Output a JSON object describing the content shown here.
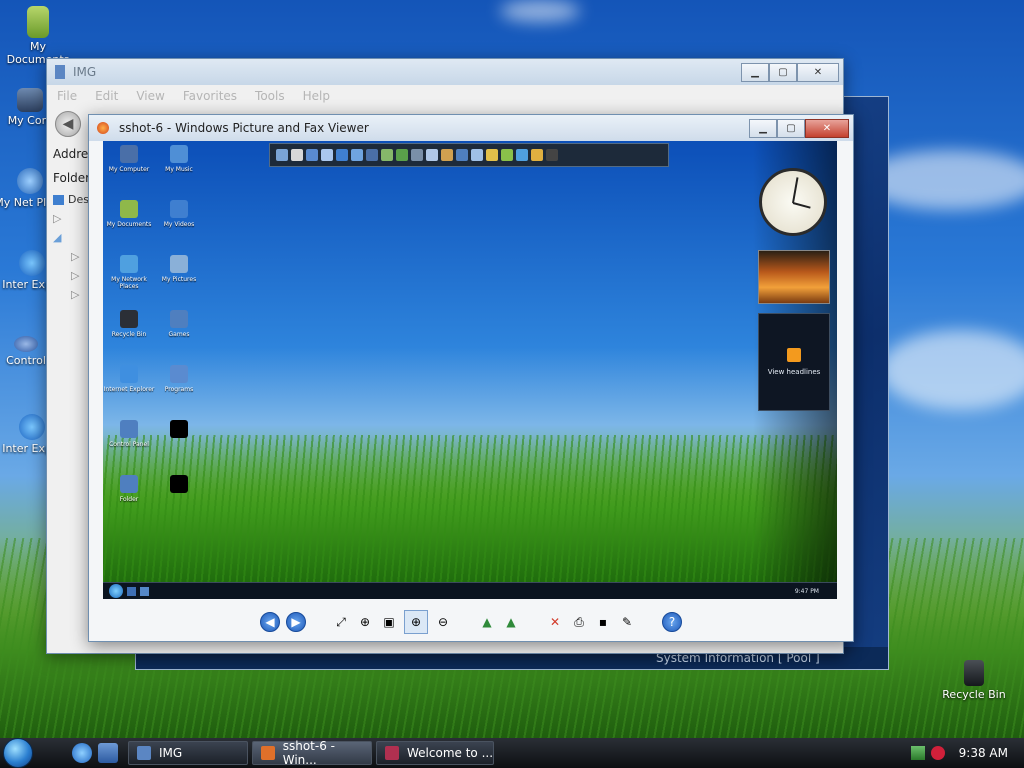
{
  "desktop": {
    "icons": [
      {
        "label": "My Documents",
        "icon": "folder-documents-icon"
      },
      {
        "label": "My Com",
        "icon": "computer-icon"
      },
      {
        "label": "My Net Place",
        "icon": "network-places-icon"
      },
      {
        "label": "Inter Explo",
        "icon": "internet-explorer-icon"
      },
      {
        "label": "Control",
        "icon": "control-panel-icon"
      },
      {
        "label": "Inter Explo",
        "icon": "internet-explorer-icon"
      }
    ],
    "recycle_bin": "Recycle Bin"
  },
  "explorer": {
    "title": "IMG",
    "menu": [
      "File",
      "Edit",
      "View",
      "Favorites",
      "Tools",
      "Help"
    ],
    "address_label": "Addres",
    "folders_label": "Folder",
    "tree_first": "Des"
  },
  "rear_window": {
    "status": "System Information [ Pool ]"
  },
  "viewer": {
    "title": "sshot-6 - Windows Picture and Fax Viewer",
    "screenshot": {
      "icons": [
        "My Computer",
        "My Music",
        "My Documents",
        "My Videos",
        "My Network Places",
        "My Pictures",
        "Recycle Bin",
        "Games",
        "Internet Explorer",
        "Programs",
        "Control Panel",
        "",
        "Folder",
        ""
      ],
      "feed_label": "View headlines",
      "clock_time": "9:47 PM"
    },
    "toolbar": [
      {
        "name": "previous-image-button",
        "icon": "arrow-left-icon",
        "glyph": "◀"
      },
      {
        "name": "next-image-button",
        "icon": "arrow-right-icon",
        "glyph": "▶"
      },
      {
        "name": "best-fit-button",
        "icon": "best-fit-icon",
        "glyph": "⤢"
      },
      {
        "name": "actual-size-button",
        "icon": "actual-size-icon",
        "glyph": "⊕"
      },
      {
        "name": "slideshow-button",
        "icon": "slideshow-icon",
        "glyph": "▣"
      },
      {
        "name": "zoom-in-button",
        "icon": "zoom-in-icon",
        "glyph": "⊕"
      },
      {
        "name": "zoom-out-button",
        "icon": "zoom-out-icon",
        "glyph": "⊖"
      },
      {
        "name": "rotate-clockwise-button",
        "icon": "rotate-clockwise-icon",
        "glyph": "▲"
      },
      {
        "name": "rotate-counterclockwise-button",
        "icon": "rotate-counterclockwise-icon",
        "glyph": "▲"
      },
      {
        "name": "delete-button",
        "icon": "delete-icon",
        "glyph": "✕"
      },
      {
        "name": "print-button",
        "icon": "print-icon",
        "glyph": "⎙"
      },
      {
        "name": "save-button",
        "icon": "save-icon",
        "glyph": "▪"
      },
      {
        "name": "edit-button",
        "icon": "edit-icon",
        "glyph": "✎"
      },
      {
        "name": "help-button",
        "icon": "help-icon",
        "glyph": "?"
      }
    ]
  },
  "taskbar": {
    "tasks": [
      {
        "label": "IMG",
        "icon": "folder-icon",
        "active": false
      },
      {
        "label": "sshot-6 - Win...",
        "icon": "picture-viewer-icon",
        "active": true
      },
      {
        "label": "Welcome to ...",
        "icon": "browser-icon",
        "active": false
      }
    ],
    "clock": "9:38 AM"
  },
  "colors": {
    "accent": "#1d58b8",
    "close": "#c4412f",
    "taskbar": "#0d0f12"
  }
}
